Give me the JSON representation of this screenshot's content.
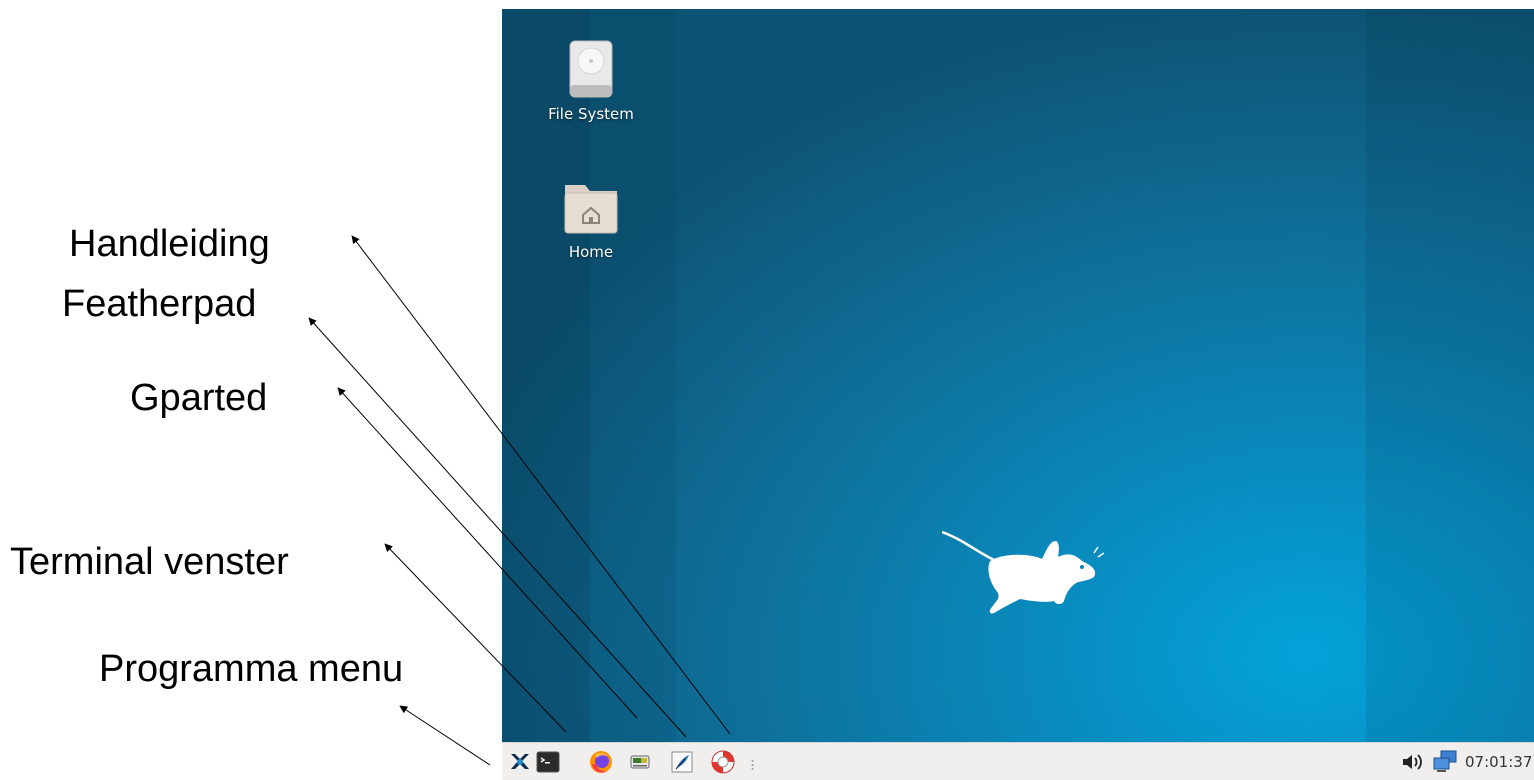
{
  "annotations": {
    "handleiding": "Handleiding",
    "featherpad": "Featherpad",
    "gparted": "Gparted",
    "terminal": "Terminal venster",
    "programma_menu": "Programma menu"
  },
  "desktop": {
    "icons": [
      {
        "label": "File System",
        "icon": "drive-harddisk-icon"
      },
      {
        "label": "Home",
        "icon": "home-folder-icon"
      }
    ],
    "wallpaper_colors": {
      "light": "#03a3da",
      "dark": "#0d5373"
    }
  },
  "taskbar": {
    "launchers": [
      {
        "name": "xfce-menu-icon"
      },
      {
        "name": "terminal-icon"
      },
      {
        "name": "firefox-icon"
      },
      {
        "name": "gparted-icon"
      },
      {
        "name": "featherpad-icon"
      },
      {
        "name": "help-lifebuoy-icon"
      }
    ],
    "clock": "07:01:37",
    "tray": {
      "volume": "volume-icon",
      "network": "network-icon"
    },
    "background": "#f0efee"
  }
}
